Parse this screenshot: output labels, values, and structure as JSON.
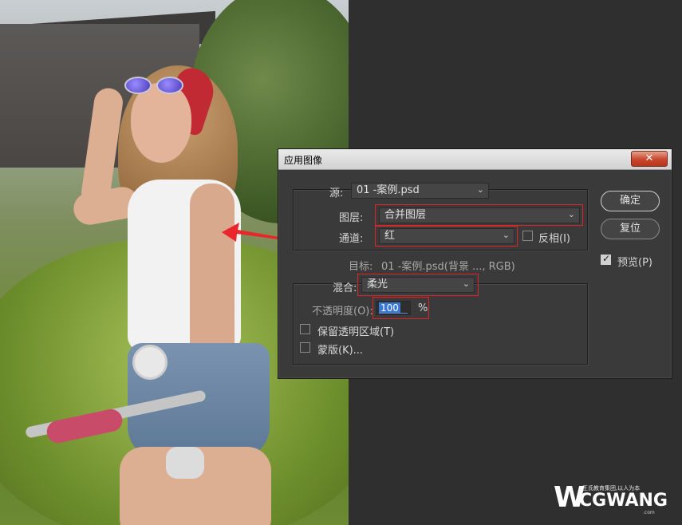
{
  "dialog": {
    "title": "应用图像",
    "close_icon": "close-icon",
    "source": {
      "label": "源:",
      "value": "01 -案例.psd"
    },
    "layer": {
      "label": "图层:",
      "value": "合并图层"
    },
    "channel": {
      "label": "通道:",
      "value": "红"
    },
    "invert": {
      "label": "反相(I)",
      "checked": false
    },
    "target": {
      "label": "目标:",
      "value": "01 -案例.psd(背景 ..., RGB)"
    },
    "blend": {
      "label": "混合:",
      "value": "柔光"
    },
    "opacity": {
      "label": "不透明度(O):",
      "value": "100",
      "unit": "%"
    },
    "preserve_transparency": {
      "label": "保留透明区域(T)",
      "checked": false
    },
    "mask": {
      "label": "蒙版(K)...",
      "checked": false
    },
    "ok_label": "确定",
    "reset_label": "复位",
    "preview": {
      "label": "预览(P)",
      "checked": true
    }
  },
  "watermark": {
    "slogan": "王氏教育集团,以人为本",
    "brand": "CGWANG",
    "domain": ".com",
    "logo_letter": "W"
  },
  "colors": {
    "highlight": "#d9262c",
    "selection": "#3a78d6",
    "panel": "#3a3a3a",
    "background": "#2f2f2f"
  }
}
